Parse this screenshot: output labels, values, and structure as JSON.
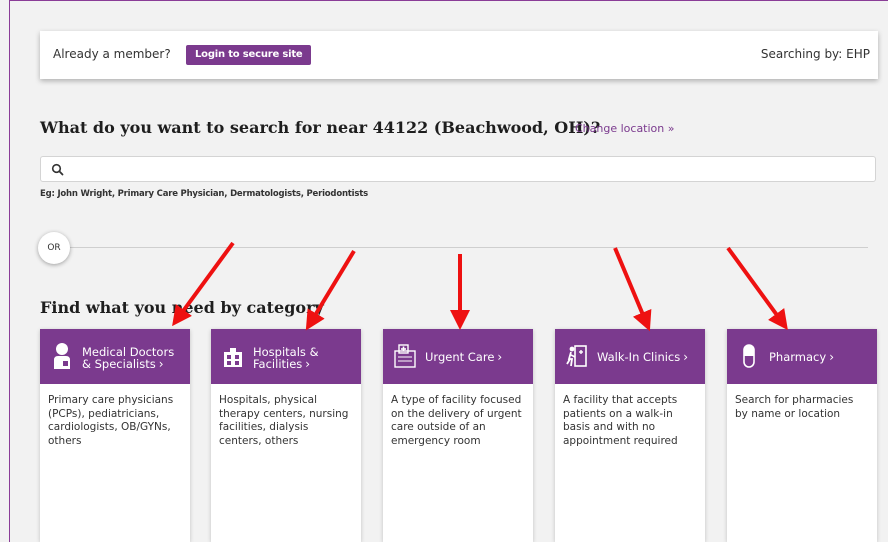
{
  "header": {
    "member_prompt": "Already a member?",
    "login_button": "Login to secure site",
    "searching_by": "Searching by: EHP"
  },
  "search": {
    "question": "What do you want to search for near 44122 (Beachwood, OH)?",
    "change_location": "Change location  »",
    "placeholder": "",
    "example": "Eg: John Wright, Primary Care Physician, Dermatologists, Periodontists"
  },
  "divider": {
    "or_label": "OR"
  },
  "categories": {
    "title": "Find what you need by category",
    "cards": [
      {
        "title": "Medical Doctors & Specialists",
        "icon": "doctor-icon",
        "description": "Primary care physicians (PCPs), pediatricians, cardiologists, OB/GYNs, others"
      },
      {
        "title": "Hospitals & Facilities",
        "icon": "hospital-icon",
        "description": "Hospitals, physical therapy centers, nursing facilities, dialysis centers, others"
      },
      {
        "title": "Urgent Care",
        "icon": "urgent-care-icon",
        "description": "A type of facility focused on the delivery of urgent care outside of an emergency room"
      },
      {
        "title": "Walk-In Clinics",
        "icon": "walk-in-clinic-icon",
        "description": "A facility that accepts patients on a walk-in basis and with no appointment required"
      },
      {
        "title": "Pharmacy",
        "icon": "pill-icon",
        "description": "Search for pharmacies by name or location"
      }
    ]
  },
  "annotations": {
    "arrow_color": "#ee1111"
  },
  "colors": {
    "brand_purple": "#7b3a8e"
  }
}
